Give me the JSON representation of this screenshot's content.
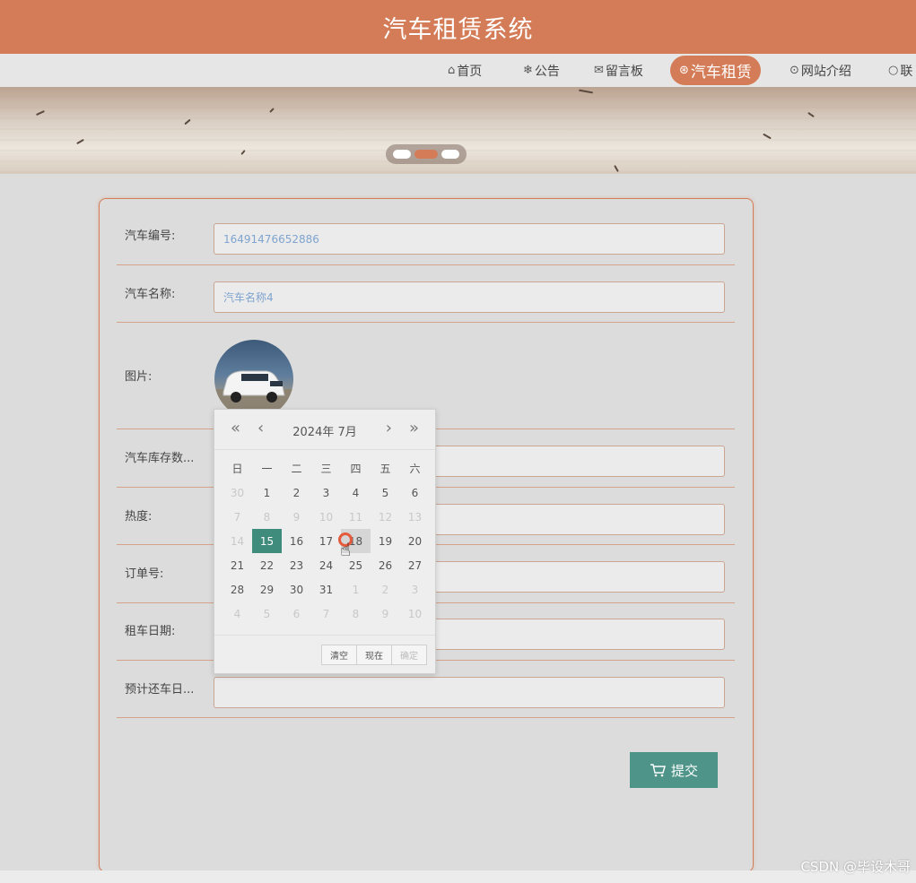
{
  "header": {
    "title": "汽车租赁系统"
  },
  "nav": {
    "items": [
      {
        "label": "首页",
        "icon": "home-icon",
        "glyph": "⌂"
      },
      {
        "label": "公告",
        "icon": "snowflake-icon",
        "glyph": "❄"
      },
      {
        "label": "留言板",
        "icon": "message-icon",
        "glyph": "✉"
      },
      {
        "label": "汽车租赁",
        "icon": "car-icon",
        "glyph": "⊛"
      },
      {
        "label": "网站介绍",
        "icon": "info-icon",
        "glyph": "⊙"
      },
      {
        "label": "联",
        "icon": "contact-icon",
        "glyph": "○"
      }
    ],
    "active": "汽车租赁"
  },
  "form": {
    "car_no_label": "汽车编号:",
    "car_no_value": "16491476652886",
    "car_name_label": "汽车名称:",
    "car_name_value": "汽车名称4",
    "image_label": "图片:",
    "stock_label": "汽车库存数...",
    "heat_label": "热度:",
    "order_label": "订单号:",
    "rent_date_label": "租车日期:",
    "return_date_label": "预计还车日...",
    "submit_label": "提交"
  },
  "datepicker": {
    "title": "2024年  7月",
    "weekdays": [
      "日",
      "一",
      "二",
      "三",
      "四",
      "五",
      "六"
    ],
    "weeks": [
      [
        "30",
        "1",
        "2",
        "3",
        "4",
        "5",
        "6"
      ],
      [
        "7",
        "8",
        "9",
        "10",
        "11",
        "12",
        "13"
      ],
      [
        "14",
        "15",
        "16",
        "17",
        "18",
        "19",
        "20"
      ],
      [
        "21",
        "22",
        "23",
        "24",
        "25",
        "26",
        "27"
      ],
      [
        "28",
        "29",
        "30",
        "31",
        "1",
        "2",
        "3"
      ],
      [
        "4",
        "5",
        "6",
        "7",
        "8",
        "9",
        "10"
      ]
    ],
    "selected": "15",
    "hovered": "18",
    "clear_label": "清空",
    "now_label": "现在",
    "confirm_label": "确定"
  },
  "watermark": "CSDN @毕设木哥",
  "colors": {
    "accent": "#d37c57",
    "teal": "#4e9488",
    "selected": "#3f8c7c"
  }
}
